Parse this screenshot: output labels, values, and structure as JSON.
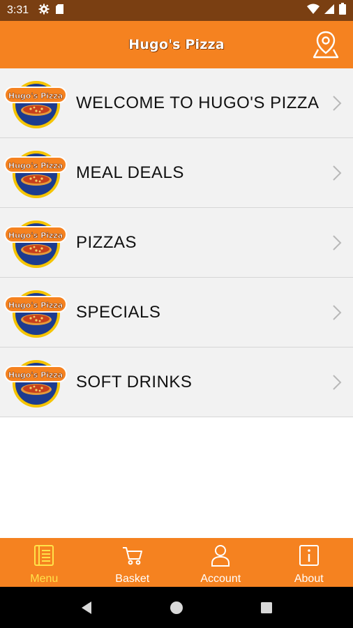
{
  "status_bar": {
    "time": "3:31",
    "left_icons": [
      "gear-icon",
      "sd-card-icon"
    ],
    "right_icons": [
      "wifi-icon",
      "signal-icon",
      "battery-icon"
    ]
  },
  "app_bar": {
    "title": "Hugo's Pizza",
    "action_icon": "location-pin-icon"
  },
  "logo": {
    "text": "Hugo's Pizza"
  },
  "menu": {
    "items": [
      {
        "label": "WELCOME TO HUGO'S PIZZA"
      },
      {
        "label": "MEAL DEALS"
      },
      {
        "label": "PIZZAS"
      },
      {
        "label": "SPECIALS"
      },
      {
        "label": "SOFT DRINKS"
      }
    ]
  },
  "bottom_nav": {
    "items": [
      {
        "label": "Menu",
        "icon": "menu-book-icon",
        "active": true
      },
      {
        "label": "Basket",
        "icon": "cart-icon",
        "active": false
      },
      {
        "label": "Account",
        "icon": "user-icon",
        "active": false
      },
      {
        "label": "About",
        "icon": "info-icon",
        "active": false
      }
    ]
  },
  "colors": {
    "status_bar": "#7a3f12",
    "brand_orange": "#f58220",
    "active_nav": "#ffe24a",
    "list_background": "#f2f2f2"
  }
}
